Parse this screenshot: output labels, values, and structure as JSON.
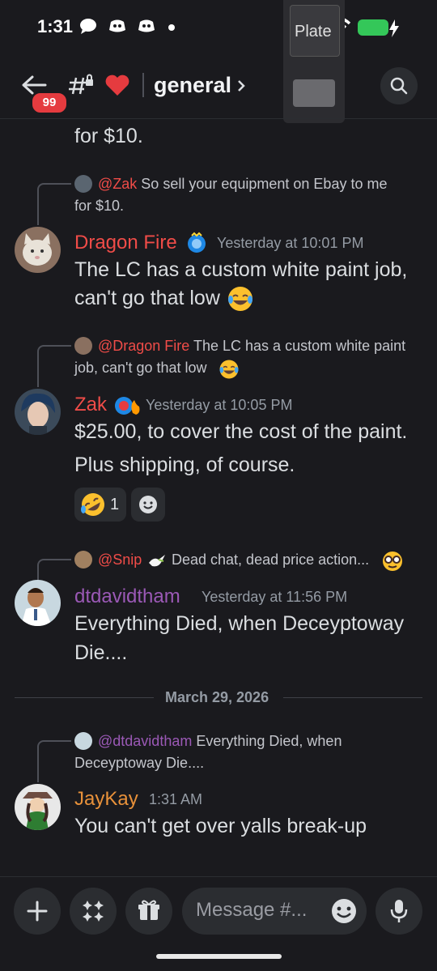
{
  "status_bar": {
    "time": "1:31"
  },
  "overlay": {
    "label": "Plate"
  },
  "header": {
    "badge_count": "99",
    "channel_name": "general"
  },
  "messages": [
    {
      "text": "for $10."
    },
    {
      "reply": {
        "name": "@Zak",
        "text_line1": "So sell your equipment on Ebay to me",
        "text_line2": "for $10."
      },
      "author": "Dragon Fire",
      "author_color": "#f04c48",
      "timestamp": "Yesterday at 10:01 PM",
      "line1": "The LC has a custom white paint job,",
      "line2": "can't go that low"
    },
    {
      "reply": {
        "name": "@Dragon Fire",
        "text_line1": "The LC has a custom white paint",
        "text_line2": "job, can't go that low"
      },
      "author": "Zak",
      "author_color": "#f04c48",
      "timestamp": "Yesterday at 10:05 PM",
      "line1": "$25.00, to cover the cost of the paint.",
      "line2": "Plus shipping, of course.",
      "reaction": {
        "emoji": "rofl",
        "count": "1"
      }
    },
    {
      "reply": {
        "name": "@Snip",
        "text_line1": "Dead chat, dead price action..."
      },
      "author": "dtdavidtham",
      "author_color": "#9b59b6",
      "timestamp": "Yesterday at 11:56 PM",
      "line1": "Everything Died, when Deceyptoway",
      "line2": "Die...."
    },
    {
      "reply": {
        "name": "@dtdavidtham",
        "text_line1": "Everything Died, when",
        "text_line2": "Deceyptoway Die...."
      },
      "author": "JayKay",
      "author_color": "#e8913a",
      "timestamp": "1:31 AM",
      "line1": "You can't get over yalls break-up"
    }
  ],
  "date_divider": "March 29, 2026",
  "composer": {
    "placeholder": "Message #..."
  }
}
